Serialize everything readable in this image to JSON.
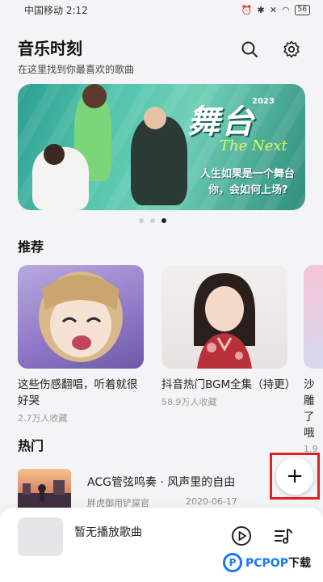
{
  "status_bar": {
    "carrier_time": "中国移动 2:12",
    "battery": "56"
  },
  "header": {
    "title": "音乐时刻",
    "subtitle": "在这里找到你最喜欢的歌曲",
    "search_icon": "search-icon",
    "settings_icon": "gear-icon"
  },
  "banner": {
    "title": "舞台",
    "year": "2023",
    "subtitle": "The Next",
    "slogan_line1": "人生如果是一个舞台",
    "slogan_line2": "你，会如何上场?",
    "page_count": 3,
    "active_page": 3
  },
  "recommend": {
    "section_title": "推荐",
    "items": [
      {
        "title": "这些伤感翻唱，听着就很好哭",
        "meta": "2.7万人收藏"
      },
      {
        "title": "抖音热门BGM全集（持更）",
        "meta": "58.9万人收藏"
      },
      {
        "title": "沙雕了哦",
        "meta": "1.9"
      }
    ]
  },
  "hot": {
    "section_title": "热门",
    "song": {
      "title": "ACG管弦鸣奏 · 风声里的自由",
      "artist": "胖虎御用铲屎官",
      "date": "2020-06-17"
    },
    "add_label": "+"
  },
  "player": {
    "now_playing": "暂无播放歌曲",
    "play_icon": "play-circle-icon",
    "playlist_icon": "playlist-icon"
  },
  "watermark": {
    "logo_text": "P",
    "brand": "PCPOP",
    "suffix": "下载"
  },
  "colors": {
    "accent": "#1677ff",
    "highlight": "#e02020",
    "banner": "#51c3ad"
  }
}
